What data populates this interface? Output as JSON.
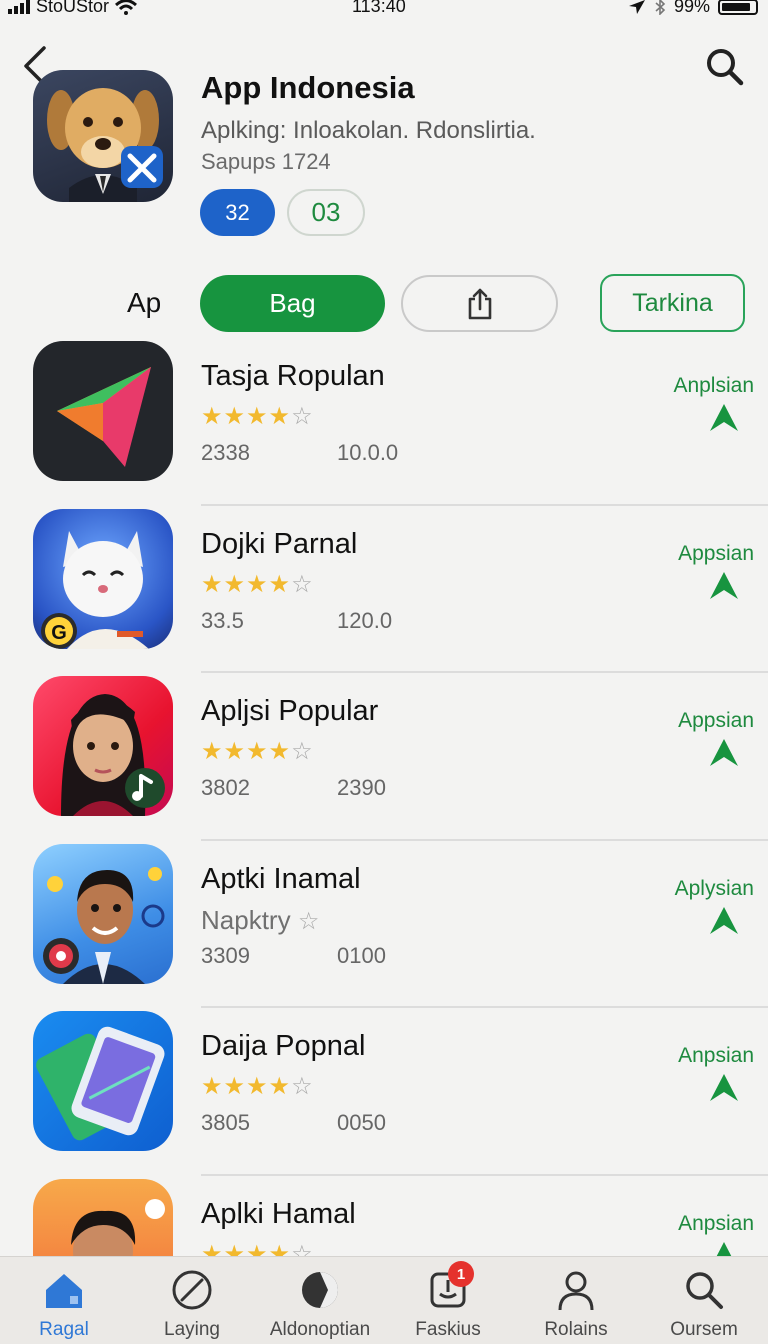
{
  "status_bar": {
    "carrier": "StoUStor",
    "time": "113:40",
    "battery": "99%",
    "signal_icon": "cellular-signal-icon",
    "wifi_icon": "wifi-icon",
    "location_icon": "location-arrow-icon",
    "bluetooth_icon": "bluetooth-icon",
    "battery_icon": "battery-icon"
  },
  "header": {
    "back_icon": "chevron-left-icon",
    "search_icon": "search-icon"
  },
  "hero": {
    "title": "App Indonesia",
    "subtitle": "Aplking: Inloakolan. Rdonslirtia.",
    "meta": "Sapups 1724",
    "pill_primary": "32",
    "pill_secondary": "03",
    "colors": {
      "pill_blue": "#1e63c9",
      "green": "#17943f"
    }
  },
  "actions": {
    "label": "Ap",
    "primary_button": "Bag",
    "share_icon": "share-icon",
    "secondary_button": "Tarkina"
  },
  "apps": [
    {
      "name": "Tasja Ropulan",
      "rating": 4,
      "rating_max": 5,
      "stat1": "2338",
      "stat2": "10.0.0",
      "action": "Anplsian",
      "icon": "play-triangle-icon"
    },
    {
      "name": "Dojki Parnal",
      "rating": 4,
      "rating_max": 5,
      "stat1": "33.5",
      "stat2": "120.0",
      "action": "Appsian",
      "icon": "white-cat-icon"
    },
    {
      "name": "Apljsi Popular",
      "rating": 4,
      "rating_max": 5,
      "stat1": "3802",
      "stat2": "2390",
      "action": "Appsian",
      "icon": "woman-portrait-icon"
    },
    {
      "name": "Aptki Inamal",
      "subtitle": "Napktry",
      "rating": 0,
      "rating_max": 1,
      "stat1": "3309",
      "stat2": "0100",
      "action": "Aplysian",
      "icon": "man-portrait-icon"
    },
    {
      "name": "Daija Popnal",
      "rating": 4,
      "rating_max": 5,
      "stat1": "3805",
      "stat2": "0050",
      "action": "Anpsian",
      "icon": "phone-cards-icon"
    },
    {
      "name": "Aplki Hamal",
      "rating": 4,
      "rating_max": 5,
      "stat1": "",
      "stat2": "",
      "action": "Anpsian",
      "icon": "man-portrait-icon"
    }
  ],
  "tab_bar": {
    "tabs": [
      {
        "label": "Ragal",
        "icon": "home-icon",
        "active": true
      },
      {
        "label": "Laying",
        "icon": "compass-icon",
        "active": false
      },
      {
        "label": "Aldonoptian",
        "icon": "contrast-icon",
        "active": false
      },
      {
        "label": "Faskius",
        "icon": "updates-icon",
        "active": false,
        "badge": "1"
      },
      {
        "label": "Rolains",
        "icon": "person-icon",
        "active": false
      },
      {
        "label": "Oursem",
        "icon": "search-icon",
        "active": false
      }
    ]
  }
}
